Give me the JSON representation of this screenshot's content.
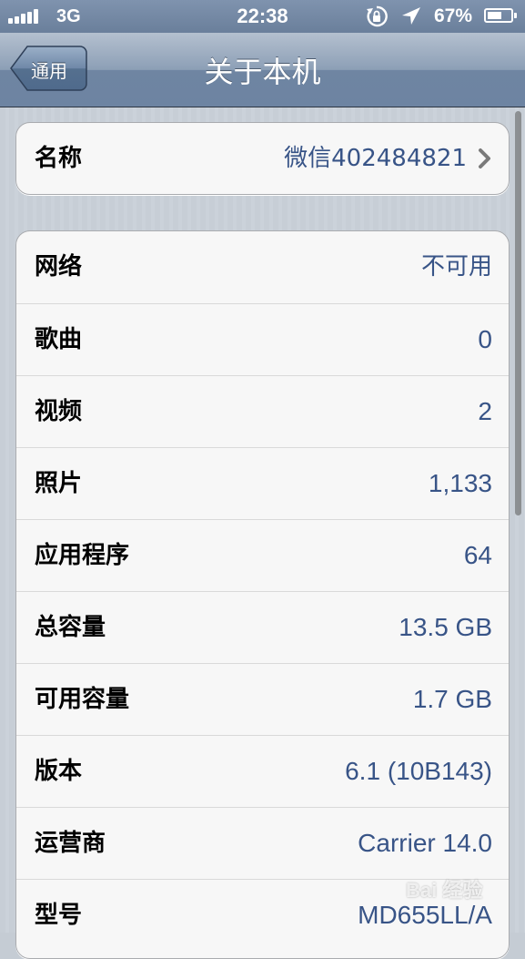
{
  "status_bar": {
    "carrier_network": "3G",
    "time": "22:38",
    "battery_percent": "67%",
    "battery_level": 0.67,
    "signal_bars": 5
  },
  "nav": {
    "back_label": "通用",
    "title": "关于本机"
  },
  "name_row": {
    "label": "名称",
    "value": "微信402484821"
  },
  "info_rows": [
    {
      "label": "网络",
      "value": "不可用"
    },
    {
      "label": "歌曲",
      "value": "0"
    },
    {
      "label": "视频",
      "value": "2"
    },
    {
      "label": "照片",
      "value": "1,133"
    },
    {
      "label": "应用程序",
      "value": "64"
    },
    {
      "label": "总容量",
      "value": "13.5 GB"
    },
    {
      "label": "可用容量",
      "value": "1.7 GB"
    },
    {
      "label": "版本",
      "value": "6.1 (10B143)"
    },
    {
      "label": "运营商",
      "value": "Carrier 14.0"
    },
    {
      "label": "型号",
      "value": "MD655LL/A"
    }
  ],
  "watermark": "Bai 经验",
  "colors": {
    "value_text": "#385487",
    "nav_bar": "#6d84a2"
  }
}
